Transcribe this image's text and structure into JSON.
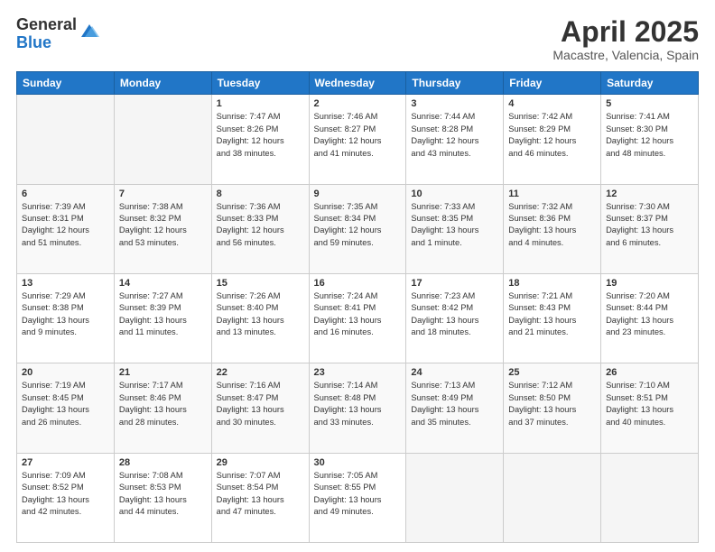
{
  "header": {
    "logo_general": "General",
    "logo_blue": "Blue",
    "title": "April 2025",
    "location": "Macastre, Valencia, Spain"
  },
  "days_of_week": [
    "Sunday",
    "Monday",
    "Tuesday",
    "Wednesday",
    "Thursday",
    "Friday",
    "Saturday"
  ],
  "weeks": [
    [
      {
        "day": "",
        "info": ""
      },
      {
        "day": "",
        "info": ""
      },
      {
        "day": "1",
        "info": "Sunrise: 7:47 AM\nSunset: 8:26 PM\nDaylight: 12 hours\nand 38 minutes."
      },
      {
        "day": "2",
        "info": "Sunrise: 7:46 AM\nSunset: 8:27 PM\nDaylight: 12 hours\nand 41 minutes."
      },
      {
        "day": "3",
        "info": "Sunrise: 7:44 AM\nSunset: 8:28 PM\nDaylight: 12 hours\nand 43 minutes."
      },
      {
        "day": "4",
        "info": "Sunrise: 7:42 AM\nSunset: 8:29 PM\nDaylight: 12 hours\nand 46 minutes."
      },
      {
        "day": "5",
        "info": "Sunrise: 7:41 AM\nSunset: 8:30 PM\nDaylight: 12 hours\nand 48 minutes."
      }
    ],
    [
      {
        "day": "6",
        "info": "Sunrise: 7:39 AM\nSunset: 8:31 PM\nDaylight: 12 hours\nand 51 minutes."
      },
      {
        "day": "7",
        "info": "Sunrise: 7:38 AM\nSunset: 8:32 PM\nDaylight: 12 hours\nand 53 minutes."
      },
      {
        "day": "8",
        "info": "Sunrise: 7:36 AM\nSunset: 8:33 PM\nDaylight: 12 hours\nand 56 minutes."
      },
      {
        "day": "9",
        "info": "Sunrise: 7:35 AM\nSunset: 8:34 PM\nDaylight: 12 hours\nand 59 minutes."
      },
      {
        "day": "10",
        "info": "Sunrise: 7:33 AM\nSunset: 8:35 PM\nDaylight: 13 hours\nand 1 minute."
      },
      {
        "day": "11",
        "info": "Sunrise: 7:32 AM\nSunset: 8:36 PM\nDaylight: 13 hours\nand 4 minutes."
      },
      {
        "day": "12",
        "info": "Sunrise: 7:30 AM\nSunset: 8:37 PM\nDaylight: 13 hours\nand 6 minutes."
      }
    ],
    [
      {
        "day": "13",
        "info": "Sunrise: 7:29 AM\nSunset: 8:38 PM\nDaylight: 13 hours\nand 9 minutes."
      },
      {
        "day": "14",
        "info": "Sunrise: 7:27 AM\nSunset: 8:39 PM\nDaylight: 13 hours\nand 11 minutes."
      },
      {
        "day": "15",
        "info": "Sunrise: 7:26 AM\nSunset: 8:40 PM\nDaylight: 13 hours\nand 13 minutes."
      },
      {
        "day": "16",
        "info": "Sunrise: 7:24 AM\nSunset: 8:41 PM\nDaylight: 13 hours\nand 16 minutes."
      },
      {
        "day": "17",
        "info": "Sunrise: 7:23 AM\nSunset: 8:42 PM\nDaylight: 13 hours\nand 18 minutes."
      },
      {
        "day": "18",
        "info": "Sunrise: 7:21 AM\nSunset: 8:43 PM\nDaylight: 13 hours\nand 21 minutes."
      },
      {
        "day": "19",
        "info": "Sunrise: 7:20 AM\nSunset: 8:44 PM\nDaylight: 13 hours\nand 23 minutes."
      }
    ],
    [
      {
        "day": "20",
        "info": "Sunrise: 7:19 AM\nSunset: 8:45 PM\nDaylight: 13 hours\nand 26 minutes."
      },
      {
        "day": "21",
        "info": "Sunrise: 7:17 AM\nSunset: 8:46 PM\nDaylight: 13 hours\nand 28 minutes."
      },
      {
        "day": "22",
        "info": "Sunrise: 7:16 AM\nSunset: 8:47 PM\nDaylight: 13 hours\nand 30 minutes."
      },
      {
        "day": "23",
        "info": "Sunrise: 7:14 AM\nSunset: 8:48 PM\nDaylight: 13 hours\nand 33 minutes."
      },
      {
        "day": "24",
        "info": "Sunrise: 7:13 AM\nSunset: 8:49 PM\nDaylight: 13 hours\nand 35 minutes."
      },
      {
        "day": "25",
        "info": "Sunrise: 7:12 AM\nSunset: 8:50 PM\nDaylight: 13 hours\nand 37 minutes."
      },
      {
        "day": "26",
        "info": "Sunrise: 7:10 AM\nSunset: 8:51 PM\nDaylight: 13 hours\nand 40 minutes."
      }
    ],
    [
      {
        "day": "27",
        "info": "Sunrise: 7:09 AM\nSunset: 8:52 PM\nDaylight: 13 hours\nand 42 minutes."
      },
      {
        "day": "28",
        "info": "Sunrise: 7:08 AM\nSunset: 8:53 PM\nDaylight: 13 hours\nand 44 minutes."
      },
      {
        "day": "29",
        "info": "Sunrise: 7:07 AM\nSunset: 8:54 PM\nDaylight: 13 hours\nand 47 minutes."
      },
      {
        "day": "30",
        "info": "Sunrise: 7:05 AM\nSunset: 8:55 PM\nDaylight: 13 hours\nand 49 minutes."
      },
      {
        "day": "",
        "info": ""
      },
      {
        "day": "",
        "info": ""
      },
      {
        "day": "",
        "info": ""
      }
    ]
  ]
}
